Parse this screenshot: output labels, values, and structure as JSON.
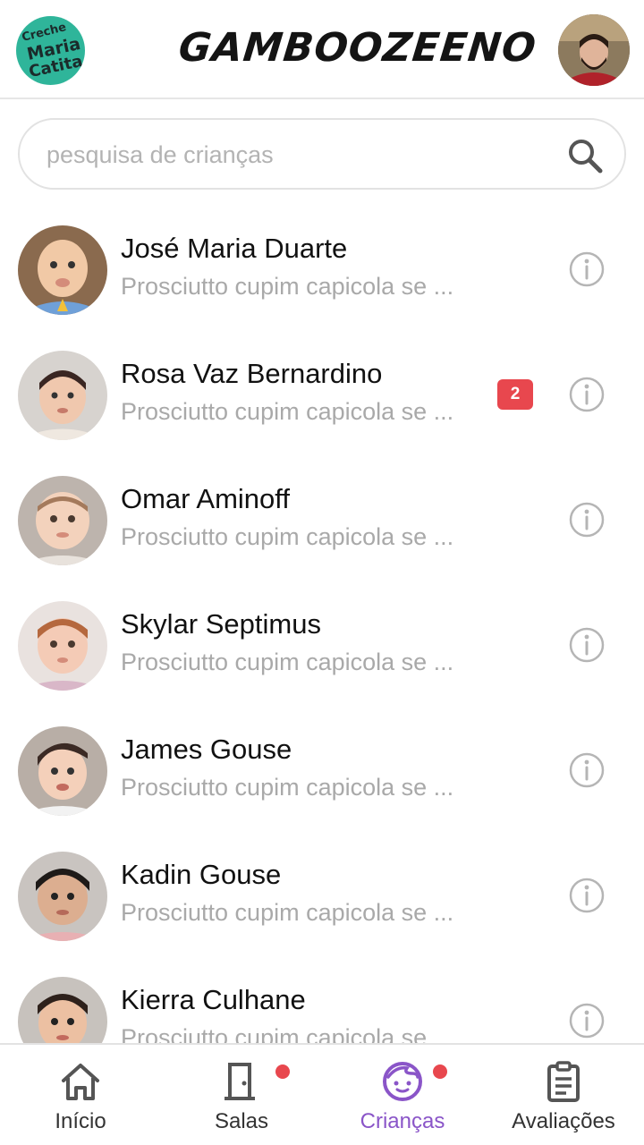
{
  "header": {
    "school_logo": {
      "line1": "Creche",
      "line2": "Maria",
      "line3": "Catita"
    },
    "brand": "GAMBOOZEENO",
    "profile_icon": "user-avatar-icon"
  },
  "search": {
    "placeholder": "pesquisa de crianças",
    "value": "",
    "icon": "search-icon"
  },
  "children": [
    {
      "name": "José Maria Duarte",
      "preview": "Prosciutto cupim capicola se ...",
      "badge": null
    },
    {
      "name": "Rosa Vaz Bernardino",
      "preview": "Prosciutto cupim capicola se ...",
      "badge": "2"
    },
    {
      "name": "Omar Aminoff",
      "preview": "Prosciutto cupim capicola se ...",
      "badge": null
    },
    {
      "name": "Skylar Septimus",
      "preview": "Prosciutto cupim capicola se ...",
      "badge": null
    },
    {
      "name": "James Gouse",
      "preview": "Prosciutto cupim capicola se ...",
      "badge": null
    },
    {
      "name": "Kadin Gouse",
      "preview": "Prosciutto cupim capicola se ...",
      "badge": null
    },
    {
      "name": "Kierra Culhane",
      "preview": "Prosciutto cupim capicola se ...",
      "badge": null
    }
  ],
  "nav": [
    {
      "label": "Início",
      "icon": "home-icon",
      "active": false,
      "dot": false
    },
    {
      "label": "Salas",
      "icon": "door-icon",
      "active": false,
      "dot": true
    },
    {
      "label": "Crianças",
      "icon": "child-face-icon",
      "active": true,
      "dot": true
    },
    {
      "label": "Avaliações",
      "icon": "clipboard-icon",
      "active": false,
      "dot": false
    }
  ],
  "colors": {
    "accent": "#8a55c8",
    "badge": "#e8474e",
    "logo_bg": "#2fb59a",
    "muted_text": "#a9a9a9"
  }
}
